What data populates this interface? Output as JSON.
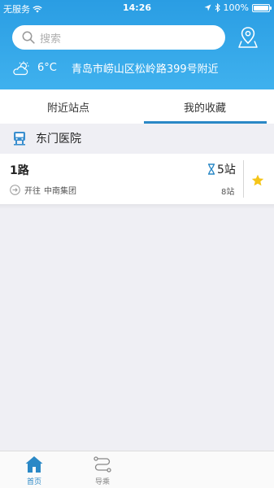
{
  "status_bar": {
    "carrier": "无服务",
    "time": "14:26",
    "battery": "100%"
  },
  "search": {
    "placeholder": "搜索"
  },
  "weather": {
    "temperature": "6°C",
    "address": "青岛市崂山区松岭路399号附近"
  },
  "tabs": [
    {
      "label": "附近站点",
      "active": false
    },
    {
      "label": "我的收藏",
      "active": true
    }
  ],
  "favorites": {
    "stop_name": "东门医院",
    "routes": [
      {
        "name": "1路",
        "arrival": "5站",
        "direction_prefix": "开往",
        "destination": "中南集团",
        "total": "8站",
        "favorited": true
      }
    ]
  },
  "tabbar": [
    {
      "label": "首页",
      "active": true
    },
    {
      "label": "导乘",
      "active": false
    }
  ],
  "colors": {
    "header": "#2a9de3",
    "accent": "#2a88c6",
    "star": "#f5c518"
  }
}
